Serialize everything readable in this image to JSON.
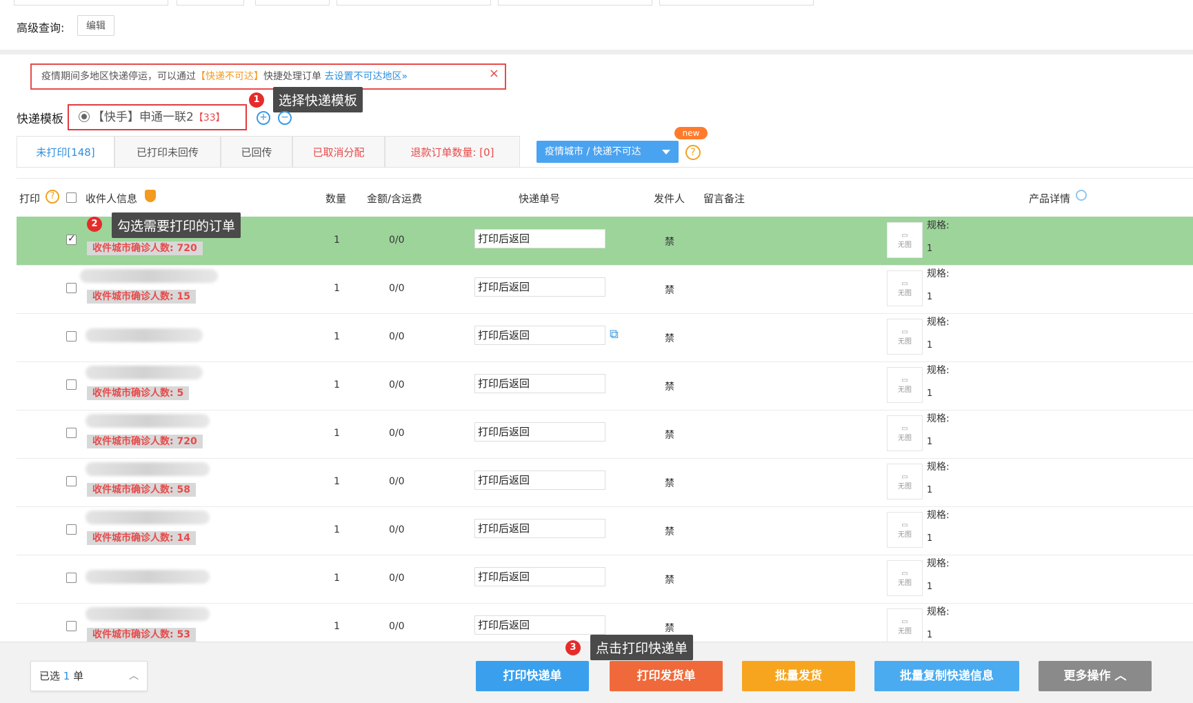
{
  "search": {
    "advanced_label": "高级查询:",
    "edit_button": "编辑"
  },
  "notice": {
    "text_before": "疫情期间多地区快递停运，可以通过",
    "highlight": "【快递不可达】",
    "text_after": "快捷处理订单",
    "link": "去设置不可达地区»",
    "close": "×"
  },
  "template": {
    "label": "快递模板",
    "name": "【快手】申通一联2",
    "count": "【33】"
  },
  "tips": {
    "step1_badge": "1",
    "step1": "选择快递模板",
    "step2_badge": "2",
    "step2": "勾选需要打印的订单",
    "step3_badge": "3",
    "step3": "点击打印快递单"
  },
  "tabs": [
    {
      "label": "未打印[148]"
    },
    {
      "label": "已打印未回传"
    },
    {
      "label": "已回传"
    },
    {
      "label": "已取消分配"
    },
    {
      "label": "退款订单数量: [0]"
    }
  ],
  "dropdown": {
    "label": "疫情城市 / 快递不可达",
    "new_badge": "new"
  },
  "table": {
    "headers": {
      "print": "打印",
      "receiver": "收件人信息",
      "qty": "数量",
      "amount": "金额/含运费",
      "tracking": "快递单号",
      "sender": "发件人",
      "note": "留言备注",
      "product": "产品详情"
    },
    "rows": [
      {
        "checked": true,
        "city": "收件城市确诊人数: 720",
        "qty": "1",
        "amount": "0/0",
        "tracking": "打印后返回",
        "sender": "禁",
        "spec": "规格:",
        "spec_qty": "1",
        "thumb": "无图"
      },
      {
        "checked": false,
        "city": "收件城市确诊人数: 15",
        "qty": "1",
        "amount": "0/0",
        "tracking": "打印后返回",
        "sender": "禁",
        "spec": "规格:",
        "spec_qty": "1",
        "thumb": "无图"
      },
      {
        "checked": false,
        "city": "",
        "qty": "1",
        "amount": "0/0",
        "tracking": "打印后返回",
        "sender": "禁",
        "spec": "规格:",
        "spec_qty": "1",
        "thumb": "无图"
      },
      {
        "checked": false,
        "city": "收件城市确诊人数: 5",
        "qty": "1",
        "amount": "0/0",
        "tracking": "打印后返回",
        "sender": "禁",
        "spec": "规格:",
        "spec_qty": "1",
        "thumb": "无图"
      },
      {
        "checked": false,
        "city": "收件城市确诊人数: 720",
        "qty": "1",
        "amount": "0/0",
        "tracking": "打印后返回",
        "sender": "禁",
        "spec": "规格:",
        "spec_qty": "1",
        "thumb": "无图"
      },
      {
        "checked": false,
        "city": "收件城市确诊人数: 58",
        "qty": "1",
        "amount": "0/0",
        "tracking": "打印后返回",
        "sender": "禁",
        "spec": "规格:",
        "spec_qty": "1",
        "thumb": "无图"
      },
      {
        "checked": false,
        "city": "收件城市确诊人数: 14",
        "qty": "1",
        "amount": "0/0",
        "tracking": "打印后返回",
        "sender": "禁",
        "spec": "规格:",
        "spec_qty": "1",
        "thumb": "无图"
      },
      {
        "checked": false,
        "city": "",
        "qty": "1",
        "amount": "0/0",
        "tracking": "打印后返回",
        "sender": "禁",
        "spec": "规格:",
        "spec_qty": "1",
        "thumb": "无图"
      },
      {
        "checked": false,
        "city": "收件城市确诊人数: 53",
        "qty": "1",
        "amount": "0/0",
        "tracking": "打印后返回",
        "sender": "禁",
        "spec": "规格:",
        "spec_qty": "1",
        "thumb": "无图"
      }
    ]
  },
  "footer": {
    "selected_prefix": "已选",
    "selected_count": "1",
    "selected_suffix": "单",
    "buttons": {
      "print_express": "打印快递单",
      "print_delivery": "打印发货单",
      "batch_ship": "批量发货",
      "batch_copy": "批量复制快递信息",
      "more": "更多操作 ︿"
    }
  },
  "colors": {
    "print_express": "#3aa0ee",
    "print_delivery": "#f0693a",
    "batch_ship": "#f7a51f",
    "batch_copy": "#4aabf0",
    "more": "#8a8a8a",
    "selected_row": "#9cd49a",
    "accent": "#2f8fde"
  }
}
